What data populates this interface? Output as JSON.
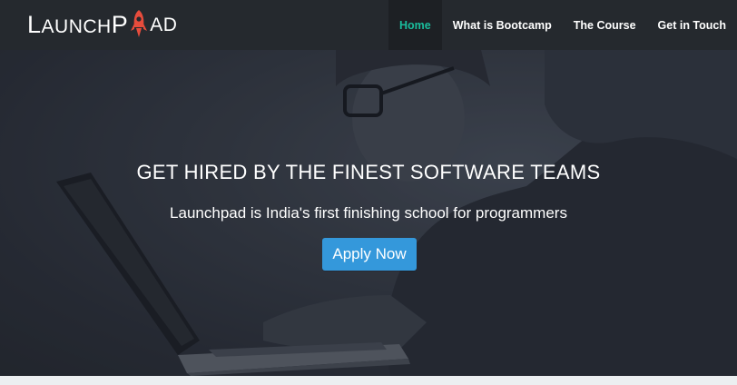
{
  "brand": {
    "part1_big": "L",
    "part1_small": "AUNCH",
    "part2_big": "P",
    "part3_small": "AD",
    "rocket_icon": "rocket-icon",
    "accent": "#e74c3c"
  },
  "nav": {
    "items": [
      {
        "label": "Home",
        "active": true
      },
      {
        "label": "What is Bootcamp",
        "active": false
      },
      {
        "label": "The Course",
        "active": false
      },
      {
        "label": "Get in Touch",
        "active": false
      }
    ],
    "active_color": "#1abc9c"
  },
  "hero": {
    "headline": "GET HIRED BY THE FINEST SOFTWARE TEAMS",
    "subhead": "Launchpad is India's first finishing school for programmers",
    "cta_label": "Apply Now",
    "cta_color": "#3498db"
  }
}
